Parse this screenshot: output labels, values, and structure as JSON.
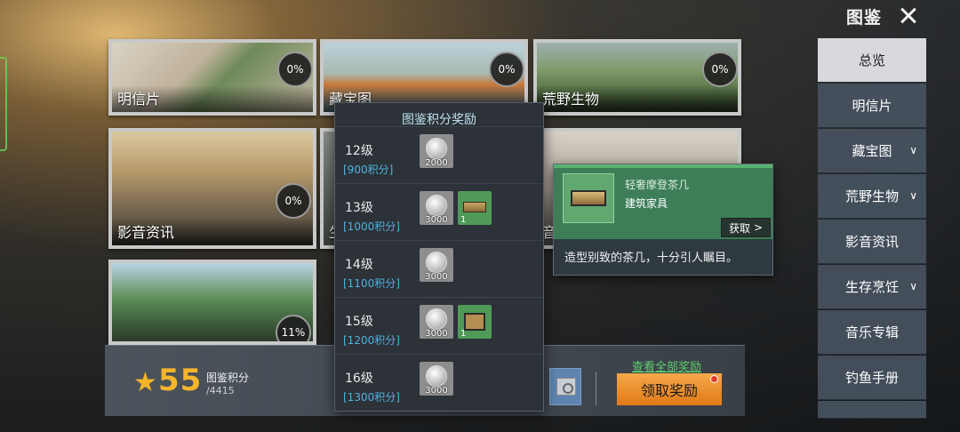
{
  "header": {
    "title": "图鉴"
  },
  "cards": [
    {
      "label": "明信片",
      "percent": "0%"
    },
    {
      "label": "藏宝图",
      "percent": "0%"
    },
    {
      "label": "荒野生物",
      "percent": "0%"
    },
    {
      "label": "影音资讯",
      "percent": "0%"
    },
    {
      "label": "生",
      "percent": ""
    },
    {
      "label": "音",
      "percent": ""
    },
    {
      "label": "",
      "percent": "11%"
    }
  ],
  "rewards_popup": {
    "title": "图鉴积分奖励",
    "levels": [
      {
        "level": "12级",
        "points": "[900积分]",
        "coin": "2000",
        "item_count": ""
      },
      {
        "level": "13级",
        "points": "[1000积分]",
        "coin": "3000",
        "item_count": "1"
      },
      {
        "level": "14级",
        "points": "[1100积分]",
        "coin": "3000",
        "item_count": ""
      },
      {
        "level": "15级",
        "points": "[1200积分]",
        "coin": "3000",
        "item_count": "1"
      },
      {
        "level": "16级",
        "points": "[1300积分]",
        "coin": "3000",
        "item_count": ""
      }
    ]
  },
  "item_tooltip": {
    "name": "轻奢摩登茶几",
    "type": "建筑家具",
    "get_label": "获取",
    "description": "造型别致的茶几，十分引人瞩目。"
  },
  "bottom": {
    "score": "55",
    "score_label": "图鉴积分",
    "score_total": "/4415",
    "view_all": "查看全部奖励",
    "claim": "领取奖励"
  },
  "nav": [
    {
      "label": "总览",
      "active": true,
      "chevron": false
    },
    {
      "label": "明信片",
      "active": false,
      "chevron": false
    },
    {
      "label": "藏宝图",
      "active": false,
      "chevron": true
    },
    {
      "label": "荒野生物",
      "active": false,
      "chevron": true
    },
    {
      "label": "影音资讯",
      "active": false,
      "chevron": false
    },
    {
      "label": "生存烹饪",
      "active": false,
      "chevron": true
    },
    {
      "label": "音乐专辑",
      "active": false,
      "chevron": false
    },
    {
      "label": "钓鱼手册",
      "active": false,
      "chevron": false
    }
  ],
  "colors": {
    "accent_gold": "#f5b52b",
    "claim_orange": "#e07a18",
    "link_green": "#5fd06e",
    "points_blue": "#4fb3e0"
  }
}
